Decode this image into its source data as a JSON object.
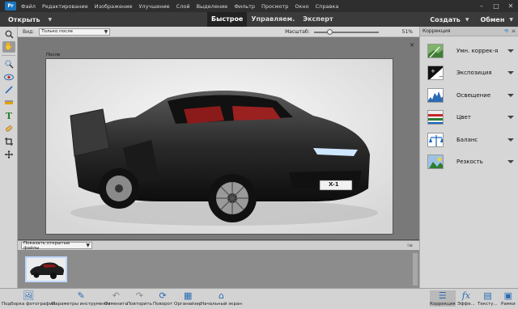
{
  "menubar": {
    "logo": "Pr",
    "items": [
      "Файл",
      "Редактирование",
      "Изображение",
      "Улучшение",
      "Слой",
      "Выделение",
      "Фильтр",
      "Просмотр",
      "Окно",
      "Справка"
    ],
    "minimize": "–",
    "maximize": "□",
    "close": "✕"
  },
  "modebar": {
    "open_label": "Открыть",
    "modes": [
      "Быстрое",
      "Управляем.",
      "Эксперт"
    ],
    "active_mode": "Быстрое",
    "create_label": "Создать",
    "share_label": "Обмен"
  },
  "options": {
    "view_label": "Вид:",
    "view_value": "Только после",
    "zoom_label": "Масштаб:",
    "zoom_value": "51%",
    "zoom_fraction": 0.25
  },
  "canvas": {
    "label": "После",
    "close": "✕",
    "plate_text": "X-1"
  },
  "bin": {
    "select_value": "Показать открытые файлы",
    "menu": "⁞≡"
  },
  "panel": {
    "title": "Коррекция",
    "items": [
      {
        "label": "Умн. коррек-я",
        "icon": "smart-fix-icon"
      },
      {
        "label": "Экспозиция",
        "icon": "exposure-icon"
      },
      {
        "label": "Освещение",
        "icon": "lighting-icon"
      },
      {
        "label": "Цвет",
        "icon": "color-icon"
      },
      {
        "label": "Баланс",
        "icon": "balance-icon"
      },
      {
        "label": "Резкость",
        "icon": "sharpen-icon"
      }
    ]
  },
  "taskbar": {
    "items": [
      {
        "label": "Подборка фотографий",
        "icon": "photo-bin-icon"
      },
      {
        "label": "Параметры инструмента",
        "icon": "tool-options-icon"
      },
      {
        "label": "Отменить",
        "icon": "undo-icon"
      },
      {
        "label": "Повторить",
        "icon": "redo-icon"
      },
      {
        "label": "Поворот",
        "icon": "rotate-icon"
      },
      {
        "label": "Органайзер",
        "icon": "organizer-icon"
      },
      {
        "label": "Начальный экран",
        "icon": "home-screen-icon"
      },
      {
        "label": "Коррекция",
        "icon": "adjustments-icon"
      },
      {
        "label": "Эффе...",
        "icon": "effects-icon"
      },
      {
        "label": "Тексту...",
        "icon": "textures-icon"
      },
      {
        "label": "Рамки",
        "icon": "frames-icon"
      }
    ]
  }
}
